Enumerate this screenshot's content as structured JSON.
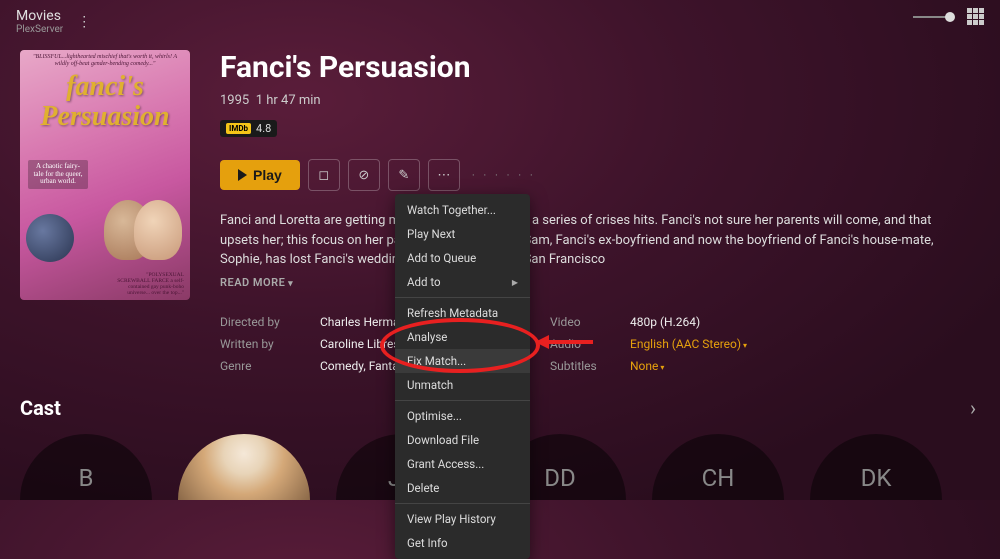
{
  "header": {
    "library": "Movies",
    "server": "PlexServer"
  },
  "movie": {
    "title": "Fanci's Persuasion",
    "year": "1995",
    "duration": "1 hr 47 min",
    "rating": "4.8",
    "poster_quote": "\"BLISSFUL...lighthearted mischief that's worth it, whirls! A wildly off-beat gender-bending comedy...\"",
    "poster_title_l1": "fanci's",
    "poster_title_l2": "Persuasion",
    "poster_tag": "A chaotic fairy-tale for the queer, urban world.",
    "poster_crit": "\"POLYSEXUAL SCREWBALL FARCE a self-contained gay punk-boho universe... over the top...\"",
    "synopsis": "Fanci and Loretta are getting married tomorrow, when a series of crises hits. Fanci's not sure her parents will come, and that upsets her; this focus on her parents upsets Loretta. Sam, Fanci's ex-boyfriend and now the boyfriend of Fanci's house-mate, Sophie, has lost Fanci's wedding dress. Plus, all over San Francisco",
    "read_more": "READ MORE"
  },
  "actions": {
    "play": "Play"
  },
  "credits": {
    "directed_label": "Directed by",
    "directed_val": "Charles Herman-Wurmfeld",
    "written_label": "Written by",
    "written_val": "Caroline Libresco",
    "genre_label": "Genre",
    "genre_val": "Comedy, Fantasy",
    "video_label": "Video",
    "video_val": "480p (H.264)",
    "audio_label": "Audio",
    "audio_val": "English (AAC Stereo)",
    "subs_label": "Subtitles",
    "subs_val": "None"
  },
  "menu": {
    "watch_together": "Watch Together...",
    "play_next": "Play Next",
    "add_queue": "Add to Queue",
    "add_to": "Add to",
    "refresh": "Refresh Metadata",
    "analyse": "Analyse",
    "fix_match": "Fix Match...",
    "unmatch": "Unmatch",
    "optimise": "Optimise...",
    "download": "Download File",
    "grant": "Grant Access...",
    "delete": "Delete",
    "history": "View Play History",
    "getinfo": "Get Info"
  },
  "cast": {
    "heading": "Cast",
    "items": [
      "B",
      "",
      "JB",
      "DD",
      "CH",
      "DK"
    ]
  }
}
